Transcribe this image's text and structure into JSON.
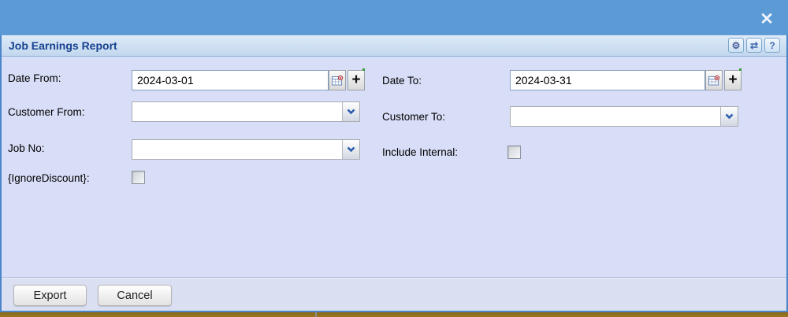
{
  "window": {
    "close_glyph": "✕"
  },
  "dialog": {
    "titlebar": {
      "title": "Job Earnings Report",
      "buttons": [
        {
          "name": "settings",
          "glyph": "⚙"
        },
        {
          "name": "refresh",
          "glyph": "⇄"
        },
        {
          "name": "help",
          "glyph": "?"
        }
      ]
    },
    "fields": {
      "date_from": {
        "label": "Date From:",
        "value": "2024-03-01"
      },
      "date_to": {
        "label": "Date To:",
        "value": "2024-03-31"
      },
      "customer_from": {
        "label": "Customer From:",
        "value": ""
      },
      "customer_to": {
        "label": "Customer To:",
        "value": ""
      },
      "job_no": {
        "label": "Job No:",
        "value": ""
      },
      "include_internal": {
        "label": "Include Internal:",
        "checked": false
      },
      "ignore_discount": {
        "label": "{IgnoreDiscount}:",
        "checked": false
      }
    },
    "buttons": {
      "plus_glyph": "+",
      "export_label": "Export",
      "cancel_label": "Cancel"
    }
  },
  "colors": {
    "page_background": "#5B9AD5",
    "dialog_border": "#4A86C8",
    "dialog_body": "#D8DEF7",
    "titlebar_gradient_top": "#DDEAF8",
    "titlebar_gradient_bottom": "#C2D7EE",
    "title_text": "#16418F",
    "bottom_strip": "#97721F",
    "chevron": "#2B5FAE",
    "calendar_dot": "#CC2222"
  }
}
